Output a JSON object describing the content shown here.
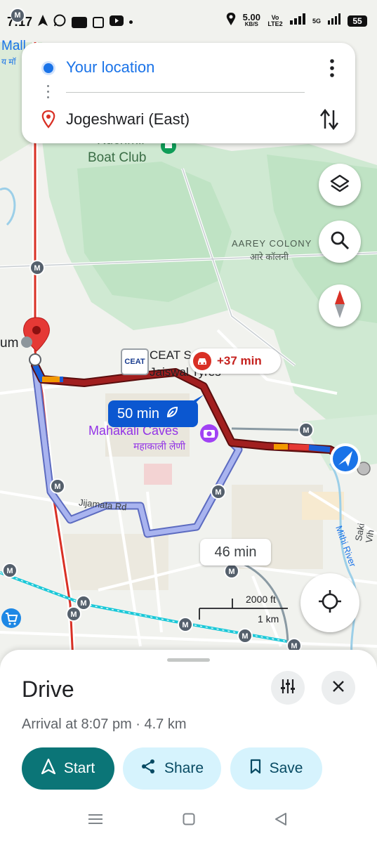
{
  "status_bar": {
    "time": "7:17",
    "speed": "5.00",
    "speed_unit": "KB/S",
    "volte": "Vo LTE2",
    "network": "5G",
    "battery": "55"
  },
  "route_card": {
    "origin": "Your location",
    "destination": "Jogeshwari (East)"
  },
  "map": {
    "labels": {
      "mall": "Mall",
      "mall_hindi": "य मॉ",
      "boat_club": "Boat Club",
      "boat_club_top": "Kuchmil",
      "aarey": "AAREY COLONY",
      "aarey_hindi": "आरे कॉलनी",
      "ceat": "CEAT S",
      "ceat_logo": "CEAT",
      "jaiswal": "Jaiswal Tyres",
      "mahakali": "Mahakali Caves",
      "mahakali_hindi": "महाकाली लेणी",
      "jijamata": "Jijamata Rd",
      "mithi": "Mithi River",
      "saki": "Saki Vih",
      "um": "um",
      "metro": "M"
    },
    "chips": {
      "delay": "+37 min",
      "eco": "50 min",
      "alt": "46 min"
    },
    "scale": {
      "feet": "2000 ft",
      "km": "1 km"
    },
    "colors": {
      "route_main": "#8b1d1d",
      "route_alt": "#9fa8e8",
      "blue_dot": "#1a73e8",
      "pin": "#e53935",
      "metro_line": "#19c8d8"
    }
  },
  "sheet": {
    "title": "Drive",
    "subtitle": "Arrival at 8:07 pm · 4.7 km",
    "start": "Start",
    "share": "Share",
    "save": "Save"
  },
  "icons": {
    "layers": "layers-icon",
    "search": "search-icon",
    "compass": "compass-icon",
    "locate": "my-location-icon",
    "options": "tune-icon",
    "close": "close-icon"
  }
}
